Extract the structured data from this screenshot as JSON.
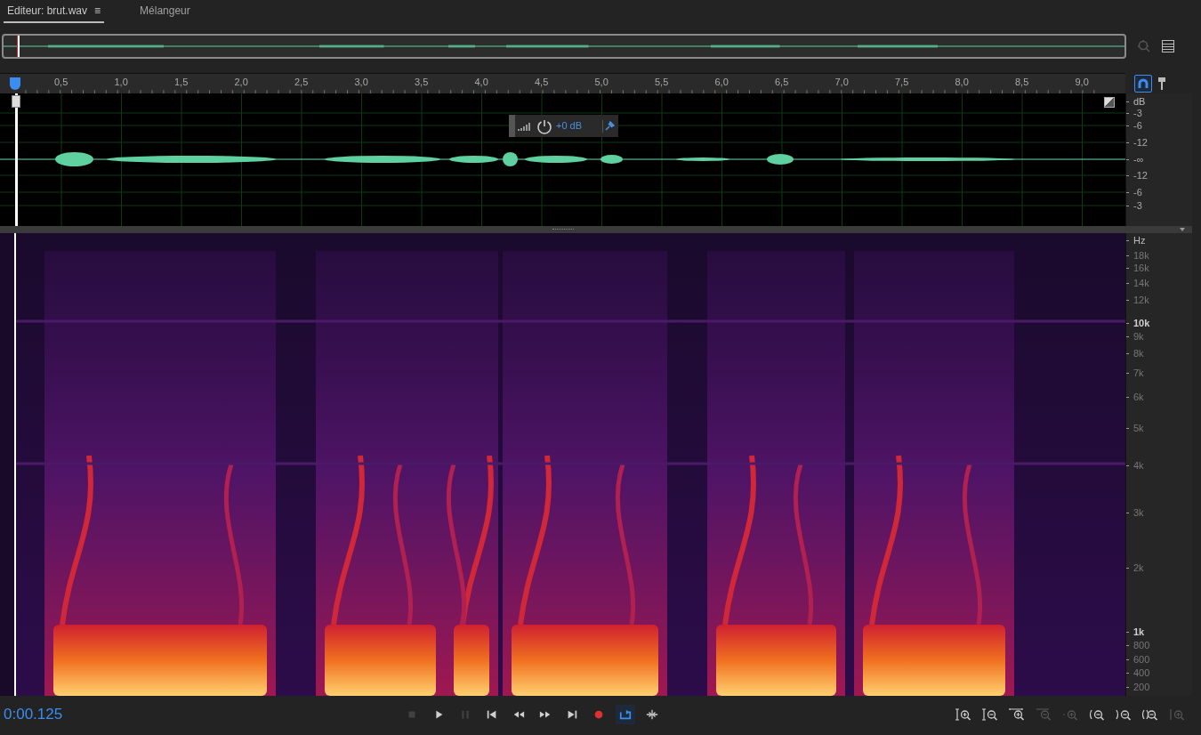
{
  "tabs": [
    {
      "label": "Editeur: brut.wav",
      "selected": true,
      "menu": "≡"
    },
    {
      "label": "Mélangeur",
      "selected": false
    }
  ],
  "ruler": {
    "ticks": [
      "0,5",
      "1,0",
      "1,5",
      "2,0",
      "2,5",
      "3,0",
      "3,5",
      "4,0",
      "4,5",
      "5,0",
      "5,5",
      "6,0",
      "6,5",
      "7,0",
      "7,5",
      "8,0",
      "8,5",
      "9,0"
    ]
  },
  "snap": {
    "on": true
  },
  "gain": {
    "value": "+0 dB"
  },
  "amplitude_scale": {
    "unit": "dB",
    "labels": [
      "-3",
      "-6",
      "-12",
      "-∞",
      "-12",
      "-6",
      "-3"
    ]
  },
  "frequency_scale": {
    "unit": "Hz",
    "labels": [
      {
        "text": "18k",
        "major": false
      },
      {
        "text": "16k",
        "major": false
      },
      {
        "text": "14k",
        "major": false
      },
      {
        "text": "12k",
        "major": false
      },
      {
        "text": "10k",
        "major": true
      },
      {
        "text": "9k",
        "major": false
      },
      {
        "text": "8k",
        "major": false
      },
      {
        "text": "7k",
        "major": false
      },
      {
        "text": "6k",
        "major": false
      },
      {
        "text": "5k",
        "major": false
      },
      {
        "text": "4k",
        "major": false
      },
      {
        "text": "3k",
        "major": false
      },
      {
        "text": "2k",
        "major": false
      },
      {
        "text": "1k",
        "major": true
      },
      {
        "text": "800",
        "major": false
      },
      {
        "text": "600",
        "major": false
      },
      {
        "text": "400",
        "major": false
      },
      {
        "text": "200",
        "major": false
      }
    ]
  },
  "time": "0:00.125",
  "transport": [
    {
      "kind": "stop",
      "disabled": true,
      "on": false
    },
    {
      "kind": "play",
      "disabled": false,
      "on": false
    },
    {
      "kind": "pause",
      "disabled": true,
      "on": false
    },
    {
      "kind": "start",
      "disabled": false,
      "on": false
    },
    {
      "kind": "rewind",
      "disabled": false,
      "on": false
    },
    {
      "kind": "forward",
      "disabled": false,
      "on": false
    },
    {
      "kind": "end",
      "disabled": false,
      "on": false
    },
    {
      "kind": "record",
      "disabled": false,
      "on": false
    },
    {
      "kind": "loop",
      "disabled": false,
      "on": true
    },
    {
      "kind": "skip",
      "disabled": false,
      "on": false
    }
  ],
  "zoom_tools": [
    {
      "kind": "amp-in",
      "disabled": false
    },
    {
      "kind": "amp-out",
      "disabled": false
    },
    {
      "kind": "time-in",
      "disabled": false
    },
    {
      "kind": "out-full",
      "disabled": true
    },
    {
      "kind": "selection",
      "disabled": true
    },
    {
      "kind": "in-left",
      "disabled": false
    },
    {
      "kind": "in-right",
      "disabled": false
    },
    {
      "kind": "in-both",
      "disabled": false
    },
    {
      "kind": "reset",
      "disabled": true
    }
  ]
}
